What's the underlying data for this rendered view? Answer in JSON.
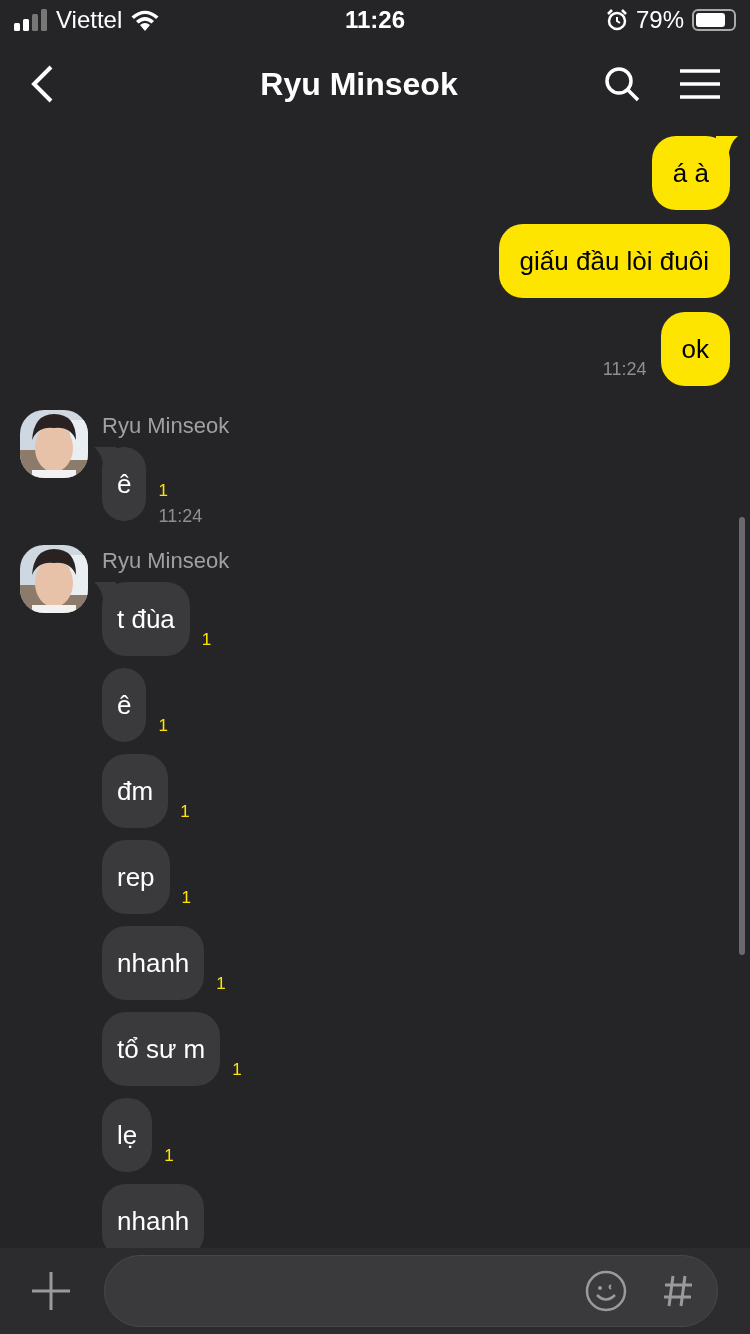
{
  "status_bar": {
    "carrier": "Viettel",
    "time": "11:26",
    "battery": "79%"
  },
  "header": {
    "title": "Ryu Minseok"
  },
  "messages": [
    {
      "kind": "sent",
      "messages": [
        {
          "text": "á à"
        },
        {
          "text": "giấu đầu lòi đuôi"
        },
        {
          "text": "ok"
        }
      ],
      "time": "11:24"
    },
    {
      "kind": "received",
      "sender": "Ryu Minseok",
      "messages": [
        {
          "text": "ê",
          "unread": "1"
        }
      ],
      "time": "11:24"
    },
    {
      "kind": "received",
      "sender": "Ryu Minseok",
      "messages": [
        {
          "text": "t đùa",
          "unread": "1"
        },
        {
          "text": "ê",
          "unread": "1"
        },
        {
          "text": "đm",
          "unread": "1"
        },
        {
          "text": "rep",
          "unread": "1"
        },
        {
          "text": "nhanh",
          "unread": "1"
        },
        {
          "text": "tổ sư m",
          "unread": "1"
        },
        {
          "text": "lẹ",
          "unread": "1"
        },
        {
          "text": "nhanh"
        }
      ]
    }
  ]
}
